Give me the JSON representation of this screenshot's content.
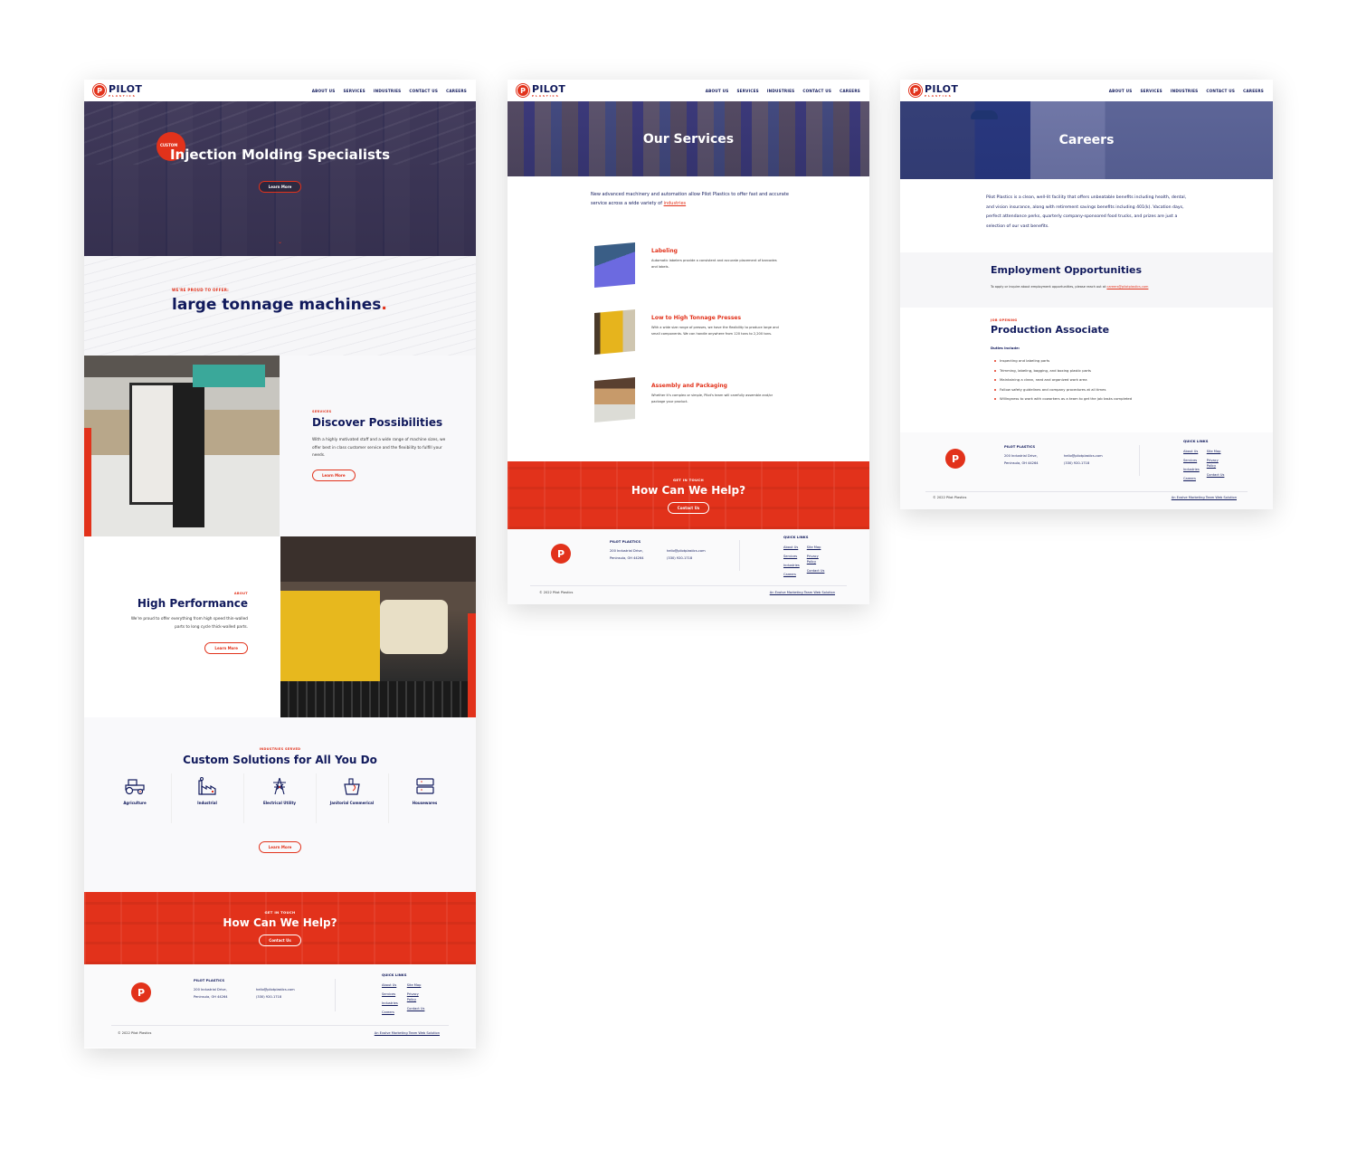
{
  "brand": {
    "name": "PILOT",
    "sub": "PLASTICS",
    "mark": "P",
    "colors": {
      "primary_red": "#e2321b",
      "navy": "#111a5c",
      "hero_overlay": "#2a2f7a"
    }
  },
  "nav": [
    "ABOUT US",
    "SERVICES",
    "INDUSTRIES",
    "CONTACT US",
    "CAREERS"
  ],
  "home": {
    "hero": {
      "badge": "CUSTOM",
      "title": "Injection Molding Specialists",
      "button": "Learn More",
      "scroll_icon": "chevron-down-icon"
    },
    "offer": {
      "eyebrow": "WE'RE PROUD TO OFFER:",
      "headline": "large tonnage machines",
      "dot": "."
    },
    "services": {
      "eyebrow": "SERVICES",
      "title": "Discover Possibilities",
      "body": "With a highly motivated staff and a wide range of machine sizes, we offer best in class customer service and the flexibility to fulfill your needs.",
      "button": "Learn More"
    },
    "about": {
      "eyebrow": "ABOUT",
      "title": "High Performance",
      "body": "We're proud to offer everything from high speed thin-walled parts to long cycle thick-walled parts.",
      "button": "Learn More"
    },
    "industries": {
      "eyebrow": "INDUSTRIES SERVED",
      "title": "Custom Solutions for All You Do",
      "items": [
        {
          "label": "Agriculture",
          "icon": "tractor-icon"
        },
        {
          "label": "Industrial",
          "icon": "factory-icon"
        },
        {
          "label": "Electrical Utility",
          "icon": "power-tower-icon"
        },
        {
          "label": "Janitorial Commerical",
          "icon": "cleaning-bucket-icon"
        },
        {
          "label": "Housewares",
          "icon": "storage-containers-icon"
        }
      ],
      "button": "Learn More"
    }
  },
  "services_page": {
    "hero_title": "Our Services",
    "intro": "New advanced machinery and automation allow Pilot Plastics to offer fast and accurate service across a wide variety of",
    "intro_link": "industries",
    "items": [
      {
        "title": "Labeling",
        "desc": "Automatic labelers provide a consistent and accurate placement of barcodes and labels."
      },
      {
        "title": "Low to High Tonnage Presses",
        "desc": "With a wide size range of presses, we have the flexibility to produce large and small components. We can handle anywhere from 120 tons to 2,200 tons."
      },
      {
        "title": "Assembly and Packaging",
        "desc": "Whether it's complex or simple, Pilot's team will carefully assemble and/or package your product."
      }
    ]
  },
  "careers_page": {
    "hero_title": "Careers",
    "intro": "Pilot Plastics is a clean, well-lit facility that offers unbeatable benefits including health, dental, and vision insurance, along with retirement savings benefits including 401(k). Vacation days, perfect attendance perks, quarterly company-sponsored food trucks, and prizes are just a selection of our vast benefits.",
    "employment": {
      "title": "Employment Opportunities",
      "text": "To apply or inquire about employment opportunities, please reach out at",
      "email": "careers@pilotplastics.com"
    },
    "job": {
      "eyebrow": "JOB OPENING",
      "title": "Production Associate",
      "duties_label": "Duties include:",
      "duties": [
        "Inspecting and labeling parts",
        "Trimming, labeling, bagging, and boxing plastic parts",
        "Maintaining a clean, neat and organized work area",
        "Follow safety guidelines and company procedures at all times",
        "Willingness to work with coworkers as a team to get the job tasks completed"
      ]
    }
  },
  "cta": {
    "eyebrow": "GET IN TOUCH",
    "title": "How Can We Help?",
    "button": "Contact Us"
  },
  "footer": {
    "company": "PILOT PLASTICS",
    "address_1": "200 Industrial Drive,",
    "address_2": "Peninsula, OH 44264",
    "email": "hello@pilotplastics.com",
    "phone": "(330) 920-1718",
    "quick_links_title": "QUICK LINKS",
    "links_col1": [
      "About Us",
      "Services",
      "Industries",
      "Careers"
    ],
    "links_col2": [
      "Site Map",
      "Privacy Policy",
      "Contact Us"
    ],
    "copyright": "© 2022 Pilot Plastics",
    "credit": "An Evolve Marketing Team Web Solution"
  }
}
